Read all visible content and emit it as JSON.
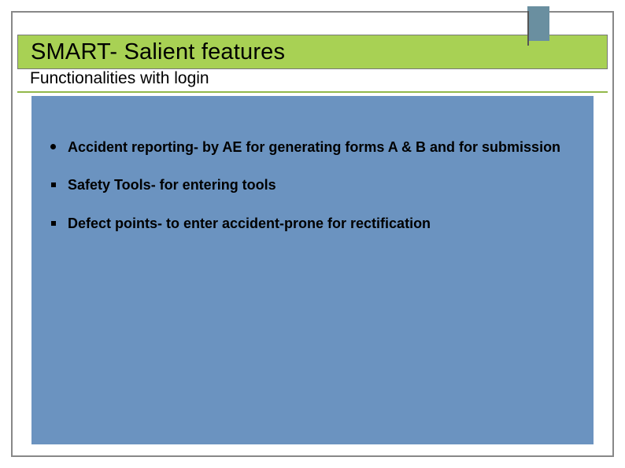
{
  "title": "SMART- Salient features",
  "subtitle": "Functionalities  with login",
  "bullets": [
    {
      "text": "Accident reporting- by AE for generating forms A & B and for submission",
      "marker": "dot"
    },
    {
      "text": "Safety Tools- for entering tools",
      "marker": "square"
    },
    {
      "text": "Defect points- to enter accident-prone for rectification",
      "marker": "square"
    }
  ]
}
